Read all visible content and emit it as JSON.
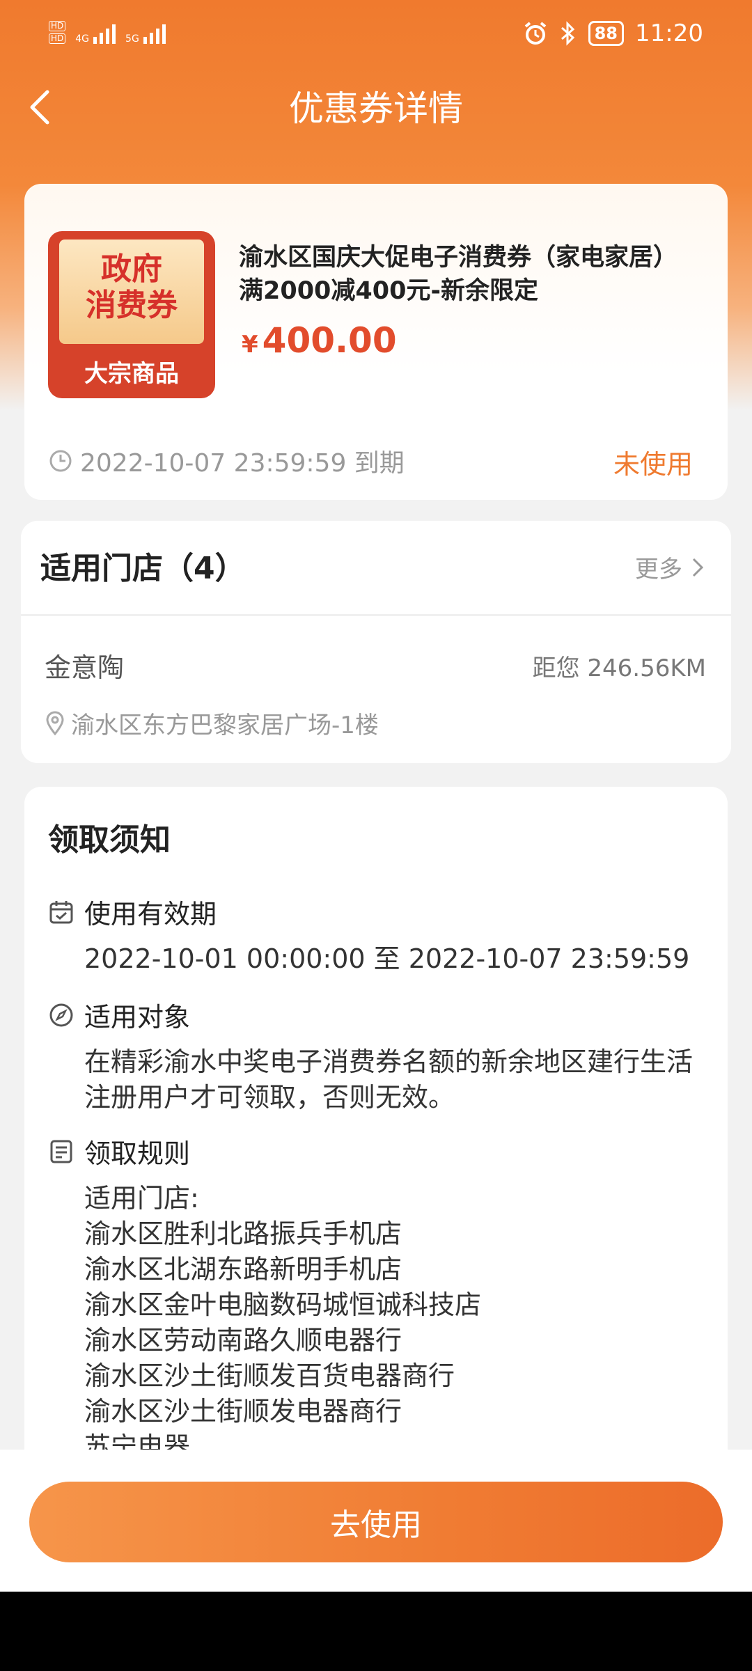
{
  "status_bar": {
    "net1": "4G",
    "net2": "5G",
    "battery": "88",
    "time": "11:20"
  },
  "nav": {
    "title": "优惠券详情"
  },
  "coupon": {
    "badge_line1": "政府",
    "badge_line2": "消费券",
    "badge_line3": "大宗商品",
    "title": "渝水区国庆大促电子消费券（家电家居）满2000减400元-新余限定",
    "currency": "¥",
    "amount": "400.00",
    "expire": "2022-10-07 23:59:59 到期",
    "status": "未使用"
  },
  "stores": {
    "heading": "适用门店（4）",
    "more": "更多",
    "name": "金意陶",
    "distance": "距您 246.56KM",
    "address": "渝水区东方巴黎家居广场-1楼"
  },
  "notice": {
    "title": "领取须知",
    "validity_label": "使用有效期",
    "validity_value": "2022-10-01 00:00:00 至 2022-10-07 23:59:59",
    "target_label": "适用对象",
    "target_value": "在精彩渝水中奖电子消费券名额的新余地区建行生活注册用户才可领取，否则无效。",
    "rules_label": "领取规则",
    "rules_lines": [
      "适用门店:",
      "渝水区胜利北路振兵手机店",
      "渝水区北湖东路新明手机店",
      "渝水区金叶电脑数码城恒诚科技店",
      "渝水区劳动南路久顺电器行",
      "渝水区沙土街顺发百货电器商行",
      "渝水区沙土街顺发电器商行",
      "苏宁电器"
    ]
  },
  "action": {
    "use_label": "去使用"
  }
}
